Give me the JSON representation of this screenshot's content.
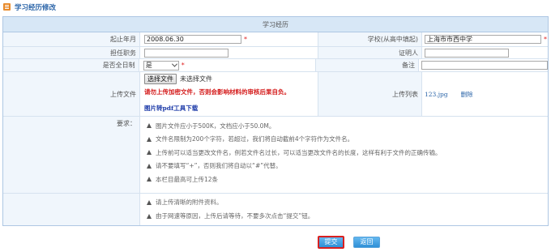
{
  "page": {
    "title": "学习经历修改"
  },
  "section": {
    "title": "学习经历"
  },
  "fields": {
    "start_label": "起止年月",
    "start_value": "2008.06.30",
    "school_label": "学校(从高中填起)",
    "school_value": "上海市市西中学",
    "position_label": "担任职务",
    "position_value": "",
    "witness_label": "证明人",
    "witness_value": "",
    "fulltime_label": "是否全日制",
    "fulltime_value": "是",
    "remark_label": "备注",
    "remark_value": "",
    "required_mark": "*"
  },
  "upload": {
    "label": "上传文件",
    "choose_button": "选择文件",
    "no_file": "未选择文件",
    "warning": "请勿上传加密文件，否则会影响材料的审核后果自负。",
    "pdf_tool_link": "图片转pdf工具下载",
    "list_label": "上传列表",
    "files": [
      {
        "name": "123.jpg",
        "delete_label": "删除"
      }
    ]
  },
  "requirements": {
    "label": "要求：",
    "group1": [
      "图片文件应小于500K，文档应小于50.0M。",
      "文件名限制为200个字符，若超过，我们将自动截前4个字符作为文件名。",
      "上传前可以适当更改文件名，例若文件名过长，可以适当更改文件名的长度，这样有利于文件的正确传输。",
      "请不要填写“+”，否则我们将自动以“#”代替。",
      "本栏目最高可上传12条"
    ],
    "group2": [
      "请上传清晰的附件资料。",
      "由于网速等原因，上传后请等待，不要多次点击“提交”钮。"
    ]
  },
  "buttons": {
    "submit": "提交",
    "back": "返回"
  },
  "colors": {
    "accent": "#2f8fd6",
    "header_bg": "#d7e7f6",
    "warning": "#d41a1a",
    "link": "#2a64a8"
  }
}
